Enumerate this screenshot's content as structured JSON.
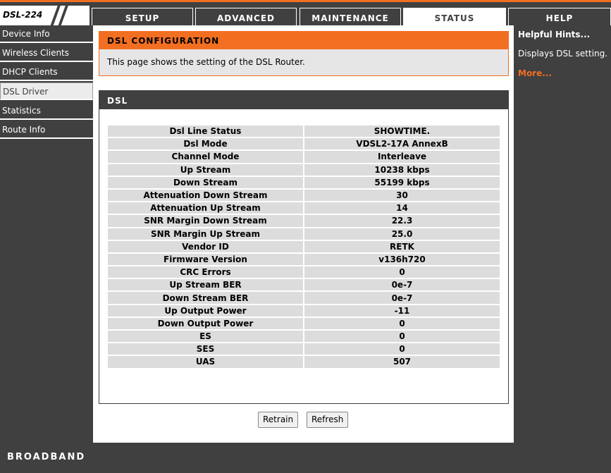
{
  "brand": {
    "model": "DSL-224",
    "footer": "BROADBAND"
  },
  "tabs": [
    {
      "label": "SETUP"
    },
    {
      "label": "ADVANCED"
    },
    {
      "label": "MAINTENANCE"
    },
    {
      "label": "STATUS",
      "active": true
    },
    {
      "label": "HELP"
    }
  ],
  "sidebar": {
    "items": [
      {
        "label": "Device Info"
      },
      {
        "label": "Wireless Clients"
      },
      {
        "label": "DHCP Clients"
      },
      {
        "label": "DSL Driver",
        "active": true
      },
      {
        "label": "Statistics"
      },
      {
        "label": "Route Info"
      }
    ]
  },
  "config": {
    "title": "DSL CONFIGURATION",
    "description": "This page shows the setting of the DSL Router."
  },
  "dsl": {
    "title": "DSL",
    "rows": [
      {
        "label": "Dsl Line Status",
        "value": "SHOWTIME."
      },
      {
        "label": "Dsl Mode",
        "value": "VDSL2-17A AnnexB"
      },
      {
        "label": "Channel Mode",
        "value": "Interleave"
      },
      {
        "label": "Up Stream",
        "value": "10238 kbps"
      },
      {
        "label": "Down Stream",
        "value": "55199 kbps"
      },
      {
        "label": "Attenuation Down Stream",
        "value": "30"
      },
      {
        "label": "Attenuation Up Stream",
        "value": "14"
      },
      {
        "label": "SNR Margin Down Stream",
        "value": "22.3"
      },
      {
        "label": "SNR Margin Up Stream",
        "value": "25.0"
      },
      {
        "label": "Vendor ID",
        "value": "RETK"
      },
      {
        "label": "Firmware Version",
        "value": "v136h720"
      },
      {
        "label": "CRC Errors",
        "value": "0"
      },
      {
        "label": "Up Stream BER",
        "value": "0e-7"
      },
      {
        "label": "Down Stream BER",
        "value": "0e-7"
      },
      {
        "label": "Up Output Power",
        "value": "-11"
      },
      {
        "label": "Down Output Power",
        "value": "0"
      },
      {
        "label": "ES",
        "value": "0"
      },
      {
        "label": "SES",
        "value": "0"
      },
      {
        "label": "UAS",
        "value": "507"
      }
    ]
  },
  "buttons": {
    "retrain": "Retrain",
    "refresh": "Refresh"
  },
  "hints": {
    "title": "Helpful Hints...",
    "text": "Displays DSL setting.",
    "more": "More..."
  },
  "colors": {
    "accent": "#f26f21",
    "dark": "#404040",
    "cell": "#dcdcdc"
  }
}
